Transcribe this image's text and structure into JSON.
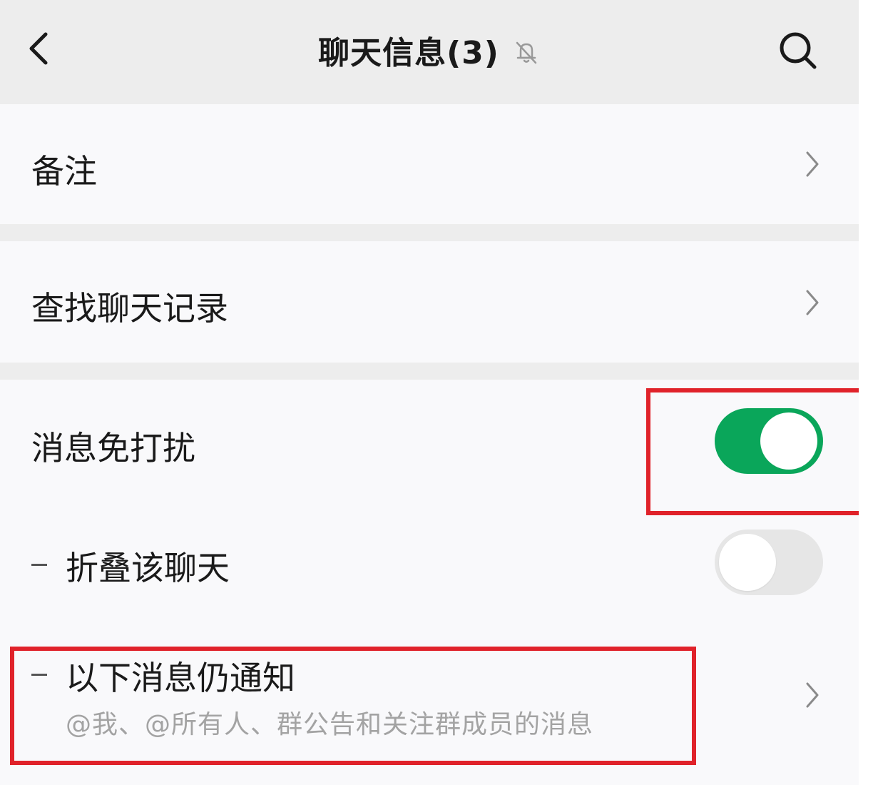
{
  "header": {
    "title": "聊天信息(3)",
    "back_icon": "chevron-left-icon",
    "mute_icon": "bell-off-icon",
    "search_icon": "search-icon"
  },
  "rows": {
    "remark": {
      "label": "备注",
      "icon": "chevron-right-icon"
    },
    "search_history": {
      "label": "查找聊天记录",
      "icon": "chevron-right-icon"
    },
    "do_not_disturb": {
      "label": "消息免打扰",
      "enabled": true
    },
    "fold_chat": {
      "label": "折叠该聊天",
      "enabled": false
    },
    "still_notify": {
      "label": "以下消息仍通知",
      "description": "@我、@所有人、群公告和关注群成员的消息",
      "icon": "chevron-right-icon"
    }
  },
  "colors": {
    "accent_green": "#0aa65a",
    "highlight_red": "#e0222a",
    "background": "#ededed",
    "row_background": "#f9f9fb"
  }
}
